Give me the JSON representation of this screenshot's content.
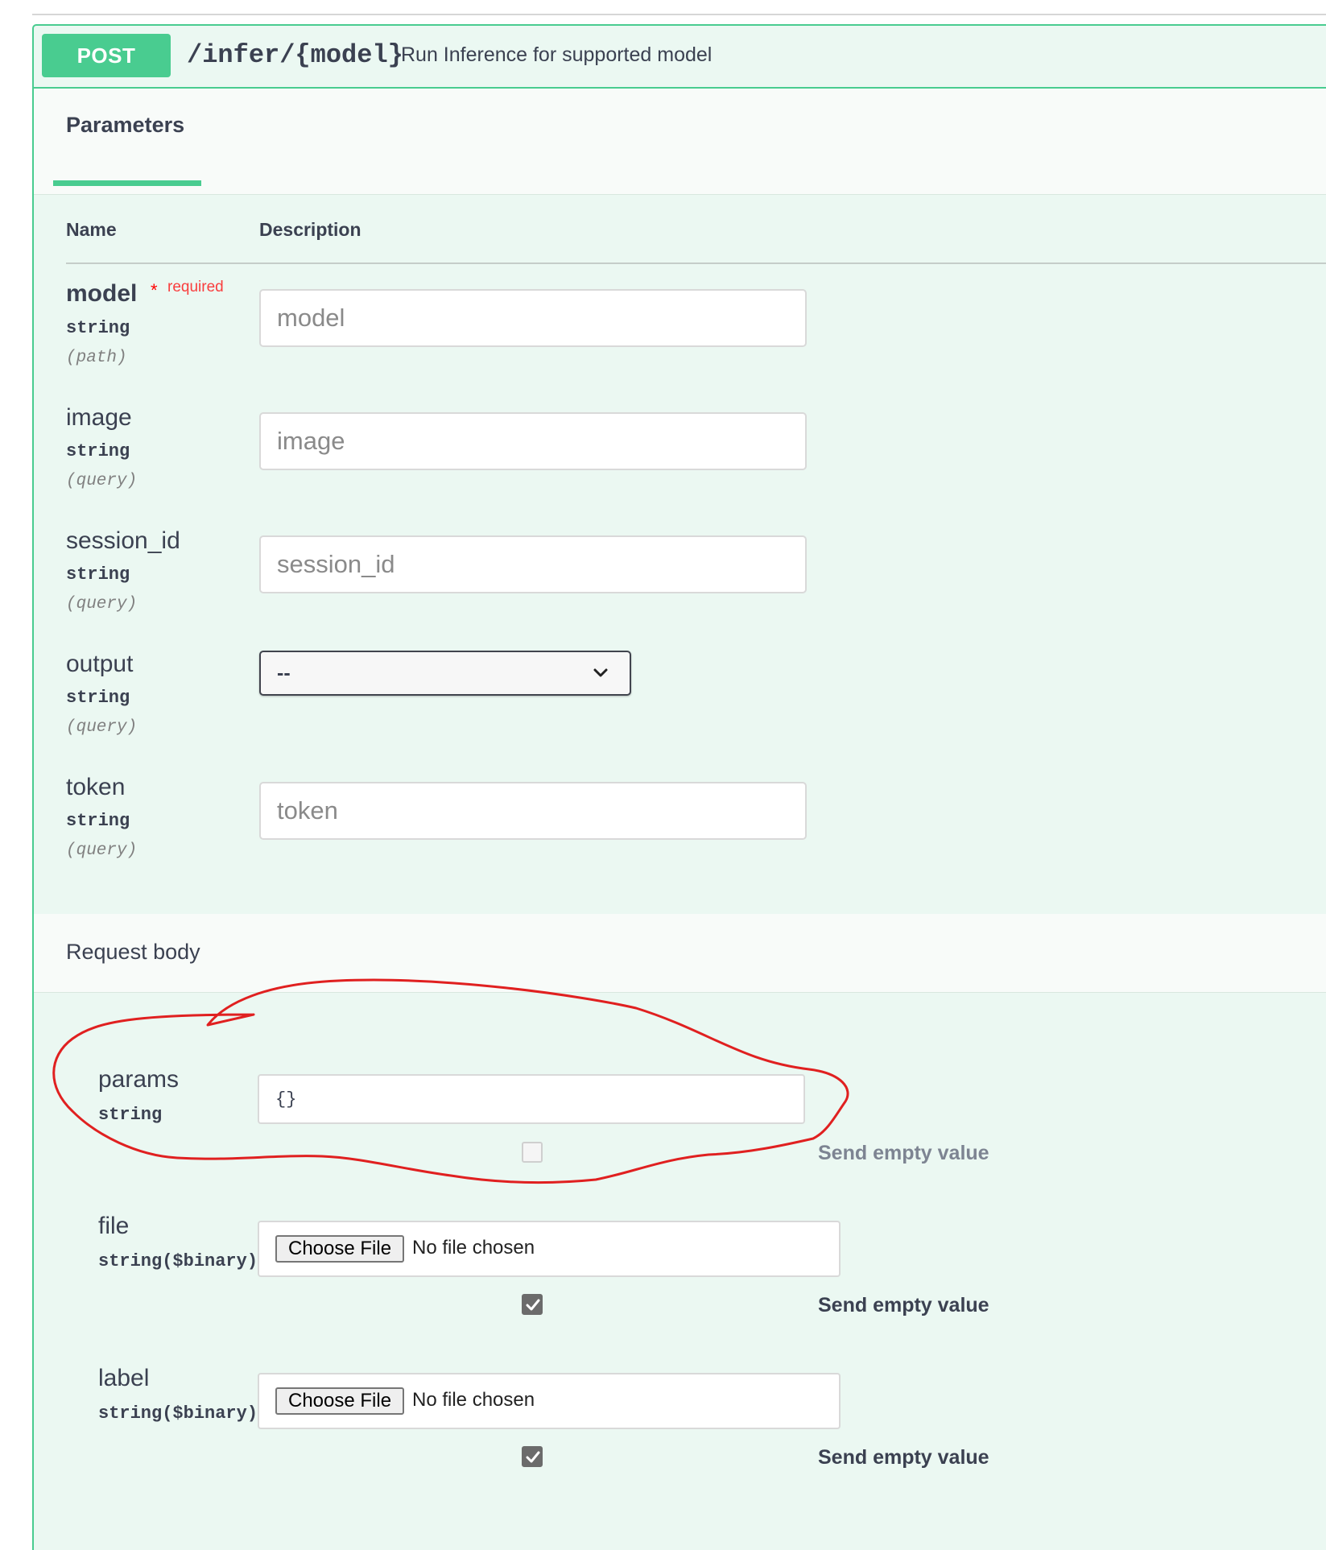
{
  "endpoint": {
    "method": "POST",
    "path": "/infer/{model}",
    "summary": "Run Inference for supported model"
  },
  "tabs": {
    "parameters_label": "Parameters"
  },
  "table": {
    "name_header": "Name",
    "description_header": "Description"
  },
  "parameters": [
    {
      "name": "model",
      "required_star": "*",
      "required_text": "required",
      "type": "string",
      "in": "(path)",
      "placeholder": "model",
      "value": ""
    },
    {
      "name": "image",
      "type": "string",
      "in": "(query)",
      "placeholder": "image",
      "value": ""
    },
    {
      "name": "session_id",
      "type": "string",
      "in": "(query)",
      "placeholder": "session_id",
      "value": ""
    },
    {
      "name": "output",
      "type": "string",
      "in": "(query)",
      "selected": "--"
    },
    {
      "name": "token",
      "type": "string",
      "in": "(query)",
      "placeholder": "token",
      "value": ""
    }
  ],
  "request_body": {
    "label": "Request body",
    "fields": [
      {
        "name": "params",
        "type": "string",
        "value": "{}",
        "send_empty_label": "Send empty value",
        "send_empty_checked": false
      },
      {
        "name": "file",
        "type": "string($binary)",
        "button_label": "Choose File",
        "file_status": "No file chosen",
        "send_empty_label": "Send empty value",
        "send_empty_checked": true
      },
      {
        "name": "label",
        "type": "string($binary)",
        "button_label": "Choose File",
        "file_status": "No file chosen",
        "send_empty_label": "Send empty value",
        "send_empty_checked": true
      }
    ]
  },
  "colors": {
    "post_green": "#49cc90",
    "panel_background": "#ebf8f2",
    "required_red": "#f93e3e",
    "annotation_red": "#e02020"
  }
}
